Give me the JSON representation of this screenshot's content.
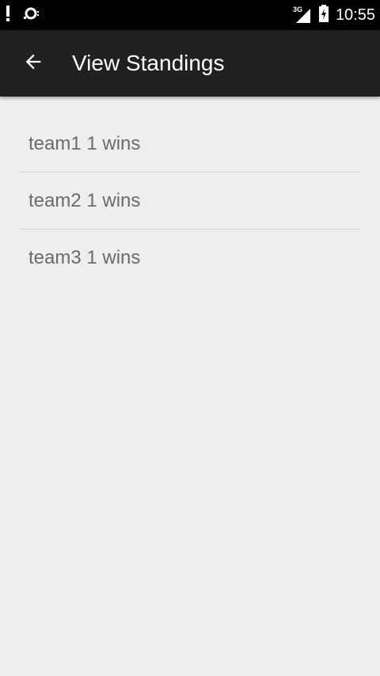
{
  "status_bar": {
    "time": "10:55",
    "network_type": "3G",
    "icons": [
      "alert-icon",
      "sync-icon",
      "signal-icon",
      "battery-icon"
    ]
  },
  "app_bar": {
    "title": "View Standings",
    "back_icon": "arrow-back-icon",
    "background": "#212121"
  },
  "standings": {
    "items": [
      {
        "label": "team1 1 wins"
      },
      {
        "label": "team2 1 wins"
      },
      {
        "label": "team3 1 wins"
      }
    ]
  },
  "colors": {
    "background": "#eeeeee",
    "item_text": "#6b6b6b",
    "divider": "#d4d4d4"
  }
}
